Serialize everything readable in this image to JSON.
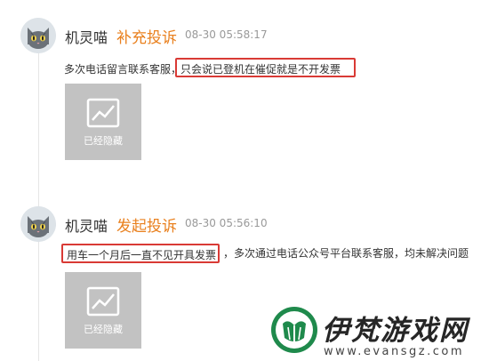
{
  "entries": [
    {
      "author": "机灵喵",
      "action": "补充投诉",
      "time": "08-30 05:58:17",
      "text_before": "多次电话留言联系客服，",
      "highlight": "只会说已登机在催促就是不开发票",
      "text_after": "",
      "image_label": "已经隐藏"
    },
    {
      "author": "机灵喵",
      "action": "发起投诉",
      "time": "08-30 05:56:10",
      "text_before": "",
      "highlight": "用车一个月后一直不见开具发票",
      "text_after": "，多次通过电话公众号平台联系客服，均未解决问题",
      "image_label": "已经隐藏"
    }
  ],
  "watermark": {
    "name": "伊梵游戏网",
    "url": "www.evansgz.com"
  },
  "colors": {
    "action": "#e9801e",
    "highlight_border": "#d93a35",
    "hidden_image_bg": "#c2c2c2",
    "logo_green": "#1f8a4c"
  },
  "icons": {
    "avatar": "cat-avatar-icon",
    "hidden_image": "image-chart-icon",
    "logo": "tulip-logo-icon"
  }
}
